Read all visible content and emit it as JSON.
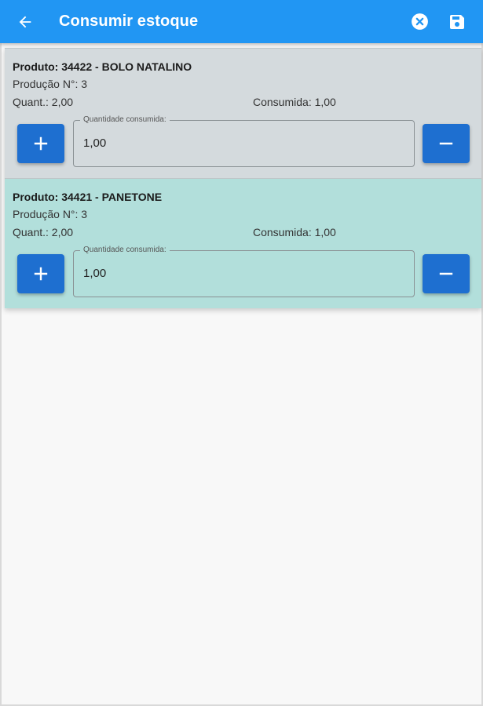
{
  "appbar": {
    "title": "Consumir estoque",
    "back_icon": "arrow-left-icon",
    "cancel_icon": "close-circle-icon",
    "save_icon": "save-icon",
    "color": "#2196f3"
  },
  "items": [
    {
      "produto": "Produto: 34422 - BOLO NATALINO",
      "producao": "Produção N°: 3",
      "quant": "Quant.: 2,00",
      "consumida": "Consumida: 1,00",
      "field_label": "Quantidade consumida:",
      "field_value": "1,00",
      "plus": "+",
      "minus": "–",
      "background": "#d4dadd"
    },
    {
      "produto": "Produto: 34421 - PANETONE",
      "producao": "Produção N°: 3",
      "quant": "Quant.: 2,00",
      "consumida": "Consumida: 1,00",
      "field_label": "Quantidade consumida:",
      "field_value": "1,00",
      "plus": "+",
      "minus": "–",
      "background": "#b2dfdb"
    }
  ]
}
